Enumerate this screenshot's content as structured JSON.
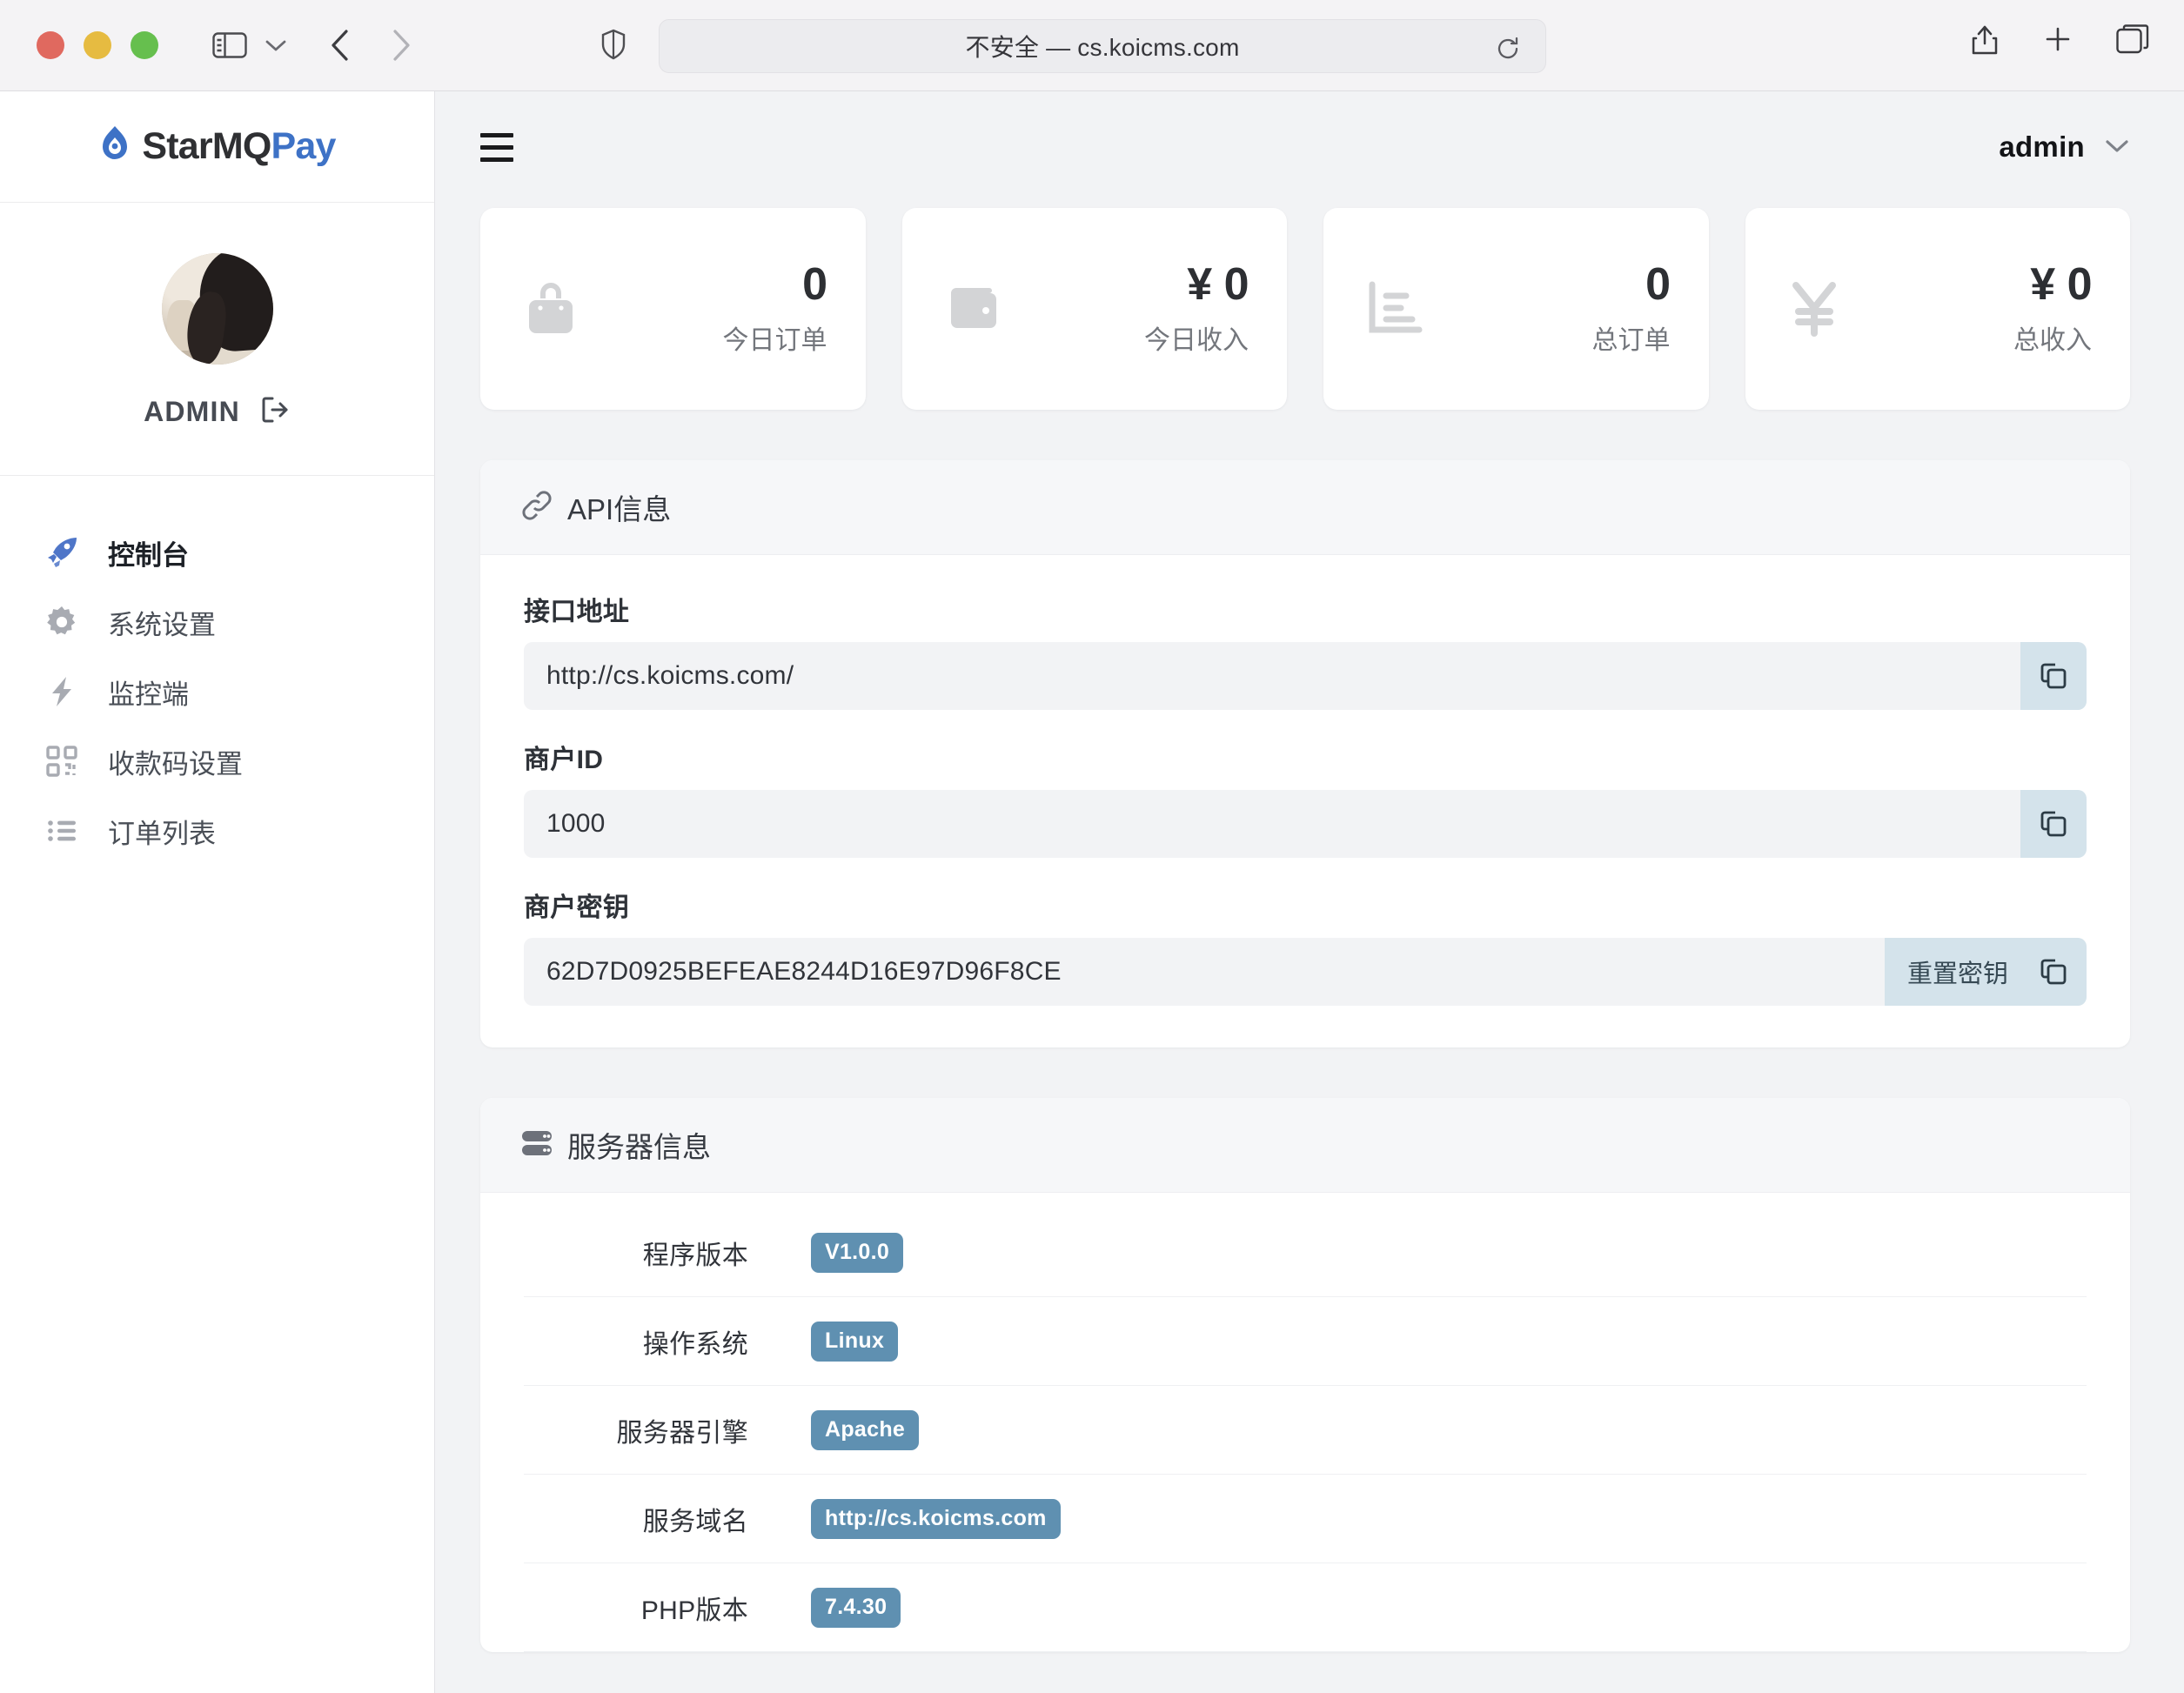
{
  "browser": {
    "url_text": "不安全 — cs.koicms.com",
    "icons": {
      "sidebar_toggle": "sidebar-toggle-icon",
      "tab_overview": "chevron-down-icon",
      "back": "back-arrow-icon",
      "forward": "forward-arrow-icon",
      "shield": "shield-icon",
      "reload": "reload-icon",
      "share": "share-icon",
      "new_tab": "plus-icon",
      "tab_overview_grid": "tabs-icon"
    }
  },
  "sidebar": {
    "brand": {
      "name_dark": "StarMQ",
      "name_accent": "Pay",
      "flame": "flame-icon"
    },
    "profile": {
      "name": "ADMIN",
      "avatar": "user-avatar",
      "logout": "logout-icon"
    },
    "items": [
      {
        "label": "控制台",
        "icon": "rocket-icon",
        "active": true
      },
      {
        "label": "系统设置",
        "icon": "gear-icon",
        "active": false
      },
      {
        "label": "监控端",
        "icon": "lightning-icon",
        "active": false
      },
      {
        "label": "收款码设置",
        "icon": "qr-code-icon",
        "active": false
      },
      {
        "label": "订单列表",
        "icon": "list-icon",
        "active": false
      }
    ]
  },
  "topbar": {
    "menu_icon": "hamburger-icon",
    "user": "admin",
    "chevron": "chevron-down-icon"
  },
  "stats": [
    {
      "icon": "shopping-bag-icon",
      "value": "0",
      "label": "今日订单"
    },
    {
      "icon": "wallet-icon",
      "value": "¥ 0",
      "label": "今日收入"
    },
    {
      "icon": "bar-chart-icon",
      "value": "0",
      "label": "总订单"
    },
    {
      "icon": "yen-icon",
      "value": "¥ 0",
      "label": "总收入"
    }
  ],
  "api_panel": {
    "icon": "link-icon",
    "title": "API信息",
    "fields": [
      {
        "label": "接口地址",
        "value": "http://cs.koicms.com/",
        "copy_label": "copy-icon",
        "reset_label": null
      },
      {
        "label": "商户ID",
        "value": "1000",
        "copy_label": "copy-icon",
        "reset_label": null
      },
      {
        "label": "商户密钥",
        "value": "62D7D0925BEFEAE8244D16E97D96F8CE",
        "copy_label": "copy-icon",
        "reset_label": "重置密钥"
      }
    ]
  },
  "server_panel": {
    "icon": "server-icon",
    "title": "服务器信息",
    "rows": [
      {
        "key": "程序版本",
        "value": "V1.0.0"
      },
      {
        "key": "操作系统",
        "value": "Linux"
      },
      {
        "key": "服务器引擎",
        "value": "Apache"
      },
      {
        "key": "服务域名",
        "value": "http://cs.koicms.com"
      },
      {
        "key": "PHP版本",
        "value": "7.4.30"
      }
    ]
  },
  "colors": {
    "brand_accent": "#3e72c6",
    "badge": "#5f90b1",
    "action_button": "#d4e3eb",
    "page_bg": "#f2f3f5"
  }
}
